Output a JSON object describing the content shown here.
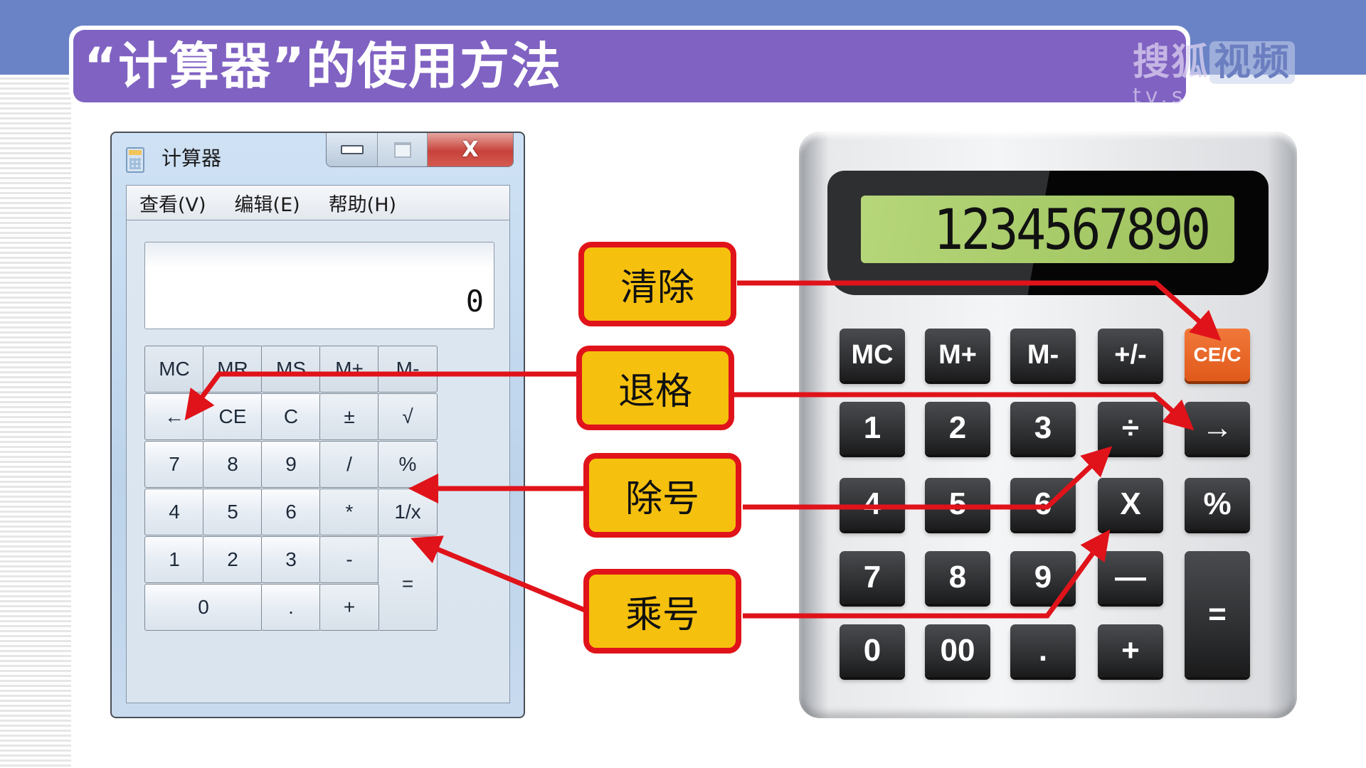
{
  "slide": {
    "title": "“计算器”的使用方法",
    "watermark": {
      "brand_a": "搜狐",
      "brand_b": "视频",
      "domain": "tv.s"
    }
  },
  "windows_calculator": {
    "window_title": "计算器",
    "caption_buttons": {
      "minimize": "—",
      "maximize": "□",
      "close": "X"
    },
    "menu": [
      "查看(V)",
      "编辑(E)",
      "帮助(H)"
    ],
    "display_value": "0",
    "keys": {
      "row1": [
        "MC",
        "MR",
        "MS",
        "M+",
        "M-"
      ],
      "row2": [
        "←",
        "CE",
        "C",
        "±",
        "√"
      ],
      "row3": [
        "7",
        "8",
        "9",
        "/",
        "%"
      ],
      "row4": [
        "4",
        "5",
        "6",
        "*",
        "1/x"
      ],
      "row5": [
        "1",
        "2",
        "3",
        "-",
        "="
      ],
      "row6": [
        "0",
        ".",
        "+"
      ]
    }
  },
  "physical_calculator": {
    "display_value": "1234567890",
    "keys": {
      "row1": [
        "MC",
        "M+",
        "M-",
        "+/-",
        "CE/C"
      ],
      "row2": [
        "1",
        "2",
        "3",
        "÷",
        "→"
      ],
      "row3": [
        "4",
        "5",
        "6",
        "X",
        "%"
      ],
      "row4": [
        "7",
        "8",
        "9",
        "—",
        "="
      ],
      "row5": [
        "0",
        "00",
        ".",
        "+"
      ]
    },
    "accent_color": "#e8641f"
  },
  "callouts": [
    {
      "label": "清除",
      "points_to": "CE/C"
    },
    {
      "label": "退格",
      "points_to": "← / →"
    },
    {
      "label": "除号",
      "points_to": "/ / ÷"
    },
    {
      "label": "乘号",
      "points_to": "* / X"
    }
  ],
  "colors": {
    "callout_fill": "#f6c00f",
    "callout_border": "#e0131a",
    "title_bar": "#7f62c2",
    "top_band": "#6a83c6"
  }
}
